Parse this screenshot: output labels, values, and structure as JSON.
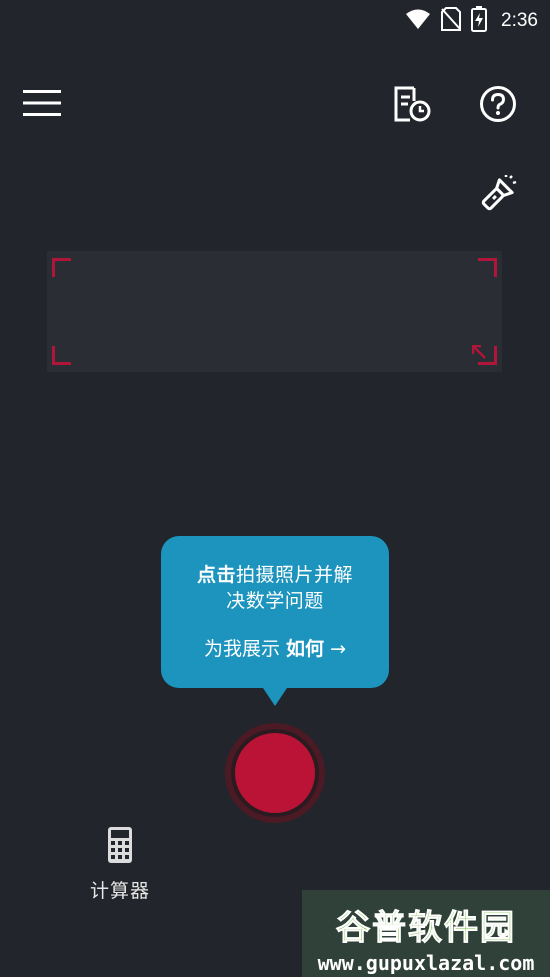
{
  "status_bar": {
    "time": "2:36",
    "icons": [
      "wifi-icon",
      "no-sim-icon",
      "battery-charging-icon"
    ]
  },
  "toolbar": {
    "icons": [
      "menu-icon",
      "history-icon",
      "help-icon",
      "flashlight-icon"
    ]
  },
  "tooltip": {
    "line1_bold": "点击",
    "line1_rest": "拍摄照片并解",
    "line2": "决数学问题",
    "show_prefix": "为我展示",
    "show_bold": "如何",
    "arrow": "→"
  },
  "calculator": {
    "label": "计算器",
    "icon": "calculator-icon"
  },
  "watermark": {
    "title": "谷普软件园",
    "url": "www.gupuxlazal.com"
  },
  "colors": {
    "background": "#22252b",
    "accent": "#bb1335",
    "tooltip": "#1c94bd",
    "scan_frame": "#2a2e34"
  }
}
